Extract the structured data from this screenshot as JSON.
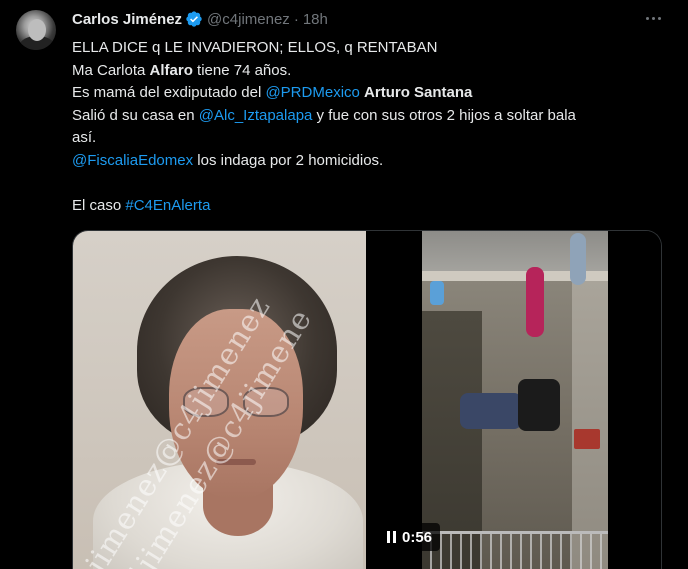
{
  "author": {
    "name": "Carlos Jiménez",
    "handle": "@c4jimenez",
    "separator": "·",
    "time": "18h"
  },
  "icons": {
    "verified": "verified-badge-icon",
    "more": "more-options-icon",
    "pause": "pause-icon"
  },
  "colors": {
    "link": "#1d9bf0",
    "verified": "#1d9bf0",
    "text": "#e7e9ea",
    "muted": "#71767b"
  },
  "tweet": {
    "l1": "ELLA DICE q LE INVADIERON; ELLOS, q RENTABAN",
    "l2a": "Ma Carlota ",
    "l2b": "Alfaro",
    "l2c": " tiene 74 años.",
    "l3a": "Es mamá del exdiputado del ",
    "l3b": "@PRDMexico",
    "l3c": " ",
    "l3d": "Arturo Santana",
    "l4a": "Salió d su casa en ",
    "l4b": "@Alc_Iztapalapa",
    "l4c": " y fue con sus otros 2 hijos a soltar bala",
    "l5": "así.",
    "l6a": "@FiscaliaEdomex",
    "l6b": " los indaga por 2 homicidios.",
    "l8a": "El caso ",
    "l8b": "#C4EnAlerta"
  },
  "media": {
    "watermark": "jimenez@c4jimenez",
    "watermark2": "4jimenez@c4jimene",
    "duration": "0:56"
  }
}
